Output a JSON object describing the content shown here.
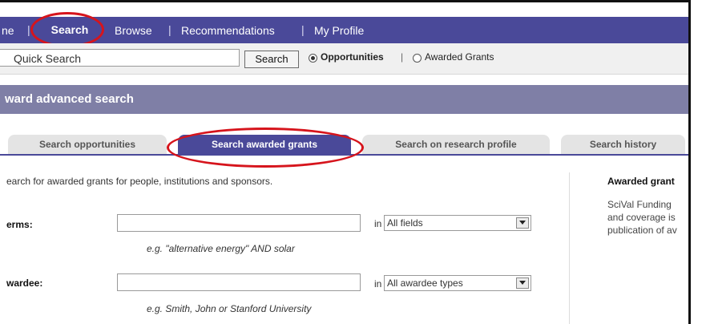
{
  "nav": {
    "items": [
      "ne",
      "Search",
      "Browse",
      "Recommendations",
      "My Profile"
    ],
    "separator": "|"
  },
  "quick_search": {
    "value": "Quick Search",
    "button_label": "Search",
    "options": [
      {
        "label": "Opportunities",
        "selected": true
      },
      {
        "label": "Awarded Grants",
        "selected": false
      }
    ],
    "option_separator": "|"
  },
  "header": {
    "title": "ward advanced search"
  },
  "tabs": [
    {
      "label": "Search opportunities",
      "active": false
    },
    {
      "label": "Search awarded grants",
      "active": true
    },
    {
      "label": "Search on research profile",
      "active": false
    },
    {
      "label": "Search history",
      "active": false
    }
  ],
  "form": {
    "description": "earch for awarded grants for people, institutions and sponsors.",
    "fields": [
      {
        "label": "erms:",
        "in_label": "in",
        "select_value": "All fields",
        "example": "e.g. \"alternative energy\" AND solar"
      },
      {
        "label": "wardee:",
        "in_label": "in",
        "select_value": "All awardee types",
        "example": "e.g. Smith, John or Stanford University"
      }
    ]
  },
  "sidebar": {
    "title": "Awarded grant",
    "lines": [
      "SciVal Funding",
      "and coverage is",
      "publication of av"
    ]
  },
  "colors": {
    "nav": "#4a4999",
    "header": "#7f7fa6",
    "highlight": "#d6141c"
  }
}
